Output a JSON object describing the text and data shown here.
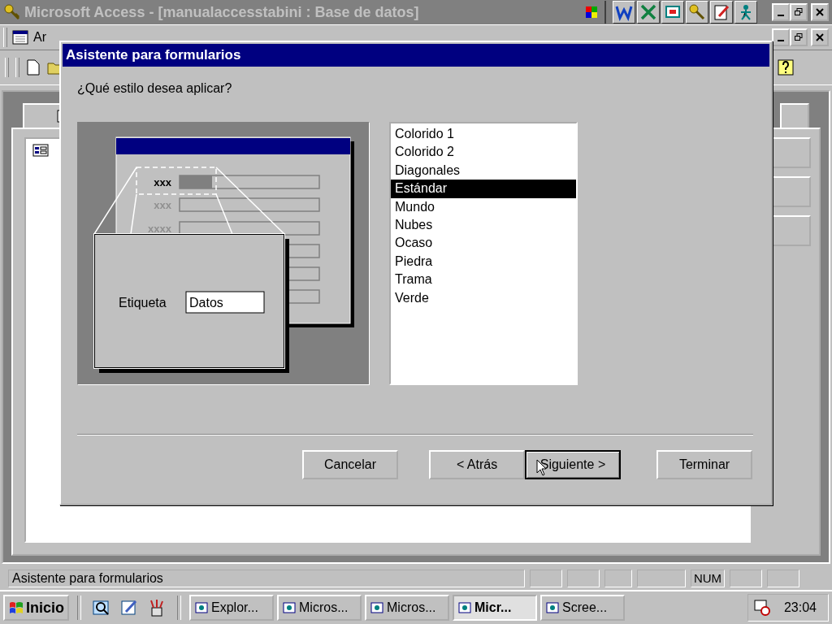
{
  "window": {
    "title": "Microsoft Access - [manualaccesstabini : Base de datos]"
  },
  "menu_bar": {
    "visible_text": "Ar"
  },
  "dialog": {
    "title": "Asistente para formularios",
    "question": "¿Qué estilo desea aplicar?",
    "preview": {
      "sample_labels": [
        "xxx",
        "xxx",
        "xxxx"
      ],
      "label": "Etiqueta",
      "value": "Datos"
    },
    "styles": [
      {
        "label": "Colorido 1",
        "selected": false
      },
      {
        "label": "Colorido 2",
        "selected": false
      },
      {
        "label": "Diagonales",
        "selected": false
      },
      {
        "label": "Estándar",
        "selected": true
      },
      {
        "label": "Mundo",
        "selected": false
      },
      {
        "label": "Nubes",
        "selected": false
      },
      {
        "label": "Ocaso",
        "selected": false
      },
      {
        "label": "Piedra",
        "selected": false
      },
      {
        "label": "Trama",
        "selected": false
      },
      {
        "label": "Verde",
        "selected": false
      }
    ],
    "buttons": [
      {
        "label": "Cancelar",
        "default": false
      },
      {
        "label": "< Atrás",
        "default": false
      },
      {
        "label": "Siguiente >",
        "default": true
      },
      {
        "label": "Terminar",
        "default": false
      }
    ]
  },
  "status_bar": {
    "text": "Asistente para formularios",
    "num_indicator": "NUM"
  },
  "taskbar": {
    "start": "Inicio",
    "tasks": [
      {
        "label": "Explor...",
        "selected": false
      },
      {
        "label": "Micros...",
        "selected": false
      },
      {
        "label": "Micros...",
        "selected": false
      },
      {
        "label": "Micr...",
        "selected": true
      },
      {
        "label": "Scree...",
        "selected": false
      }
    ],
    "clock": "23:04"
  }
}
